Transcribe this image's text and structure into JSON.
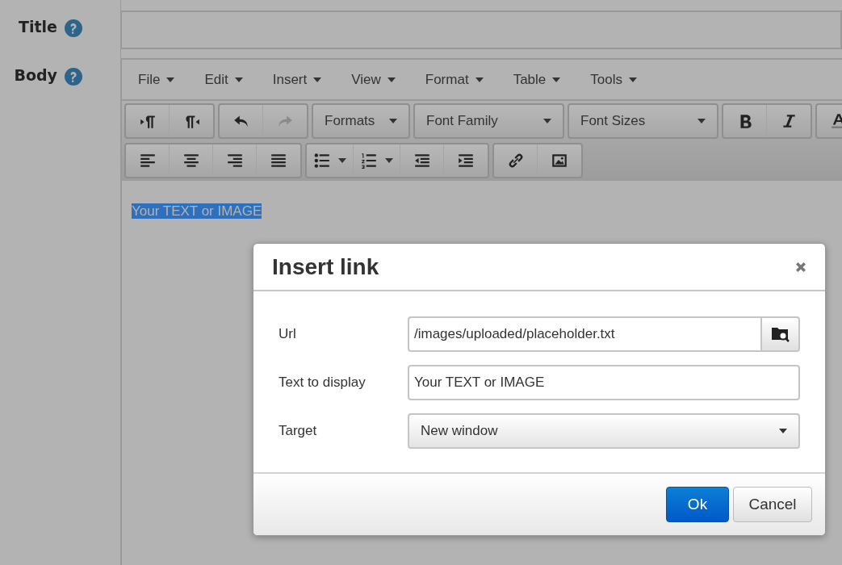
{
  "form": {
    "fields": [
      {
        "label": "Title",
        "kind": "text"
      },
      {
        "label": "Body",
        "kind": "editor"
      }
    ]
  },
  "editor": {
    "menu": [
      {
        "label": "File"
      },
      {
        "label": "Edit"
      },
      {
        "label": "Insert"
      },
      {
        "label": "View"
      },
      {
        "label": "Format"
      },
      {
        "label": "Table"
      },
      {
        "label": "Tools"
      }
    ],
    "toolbar_rows": [
      [
        [
          {
            "kind": "icon",
            "disabled": false
          },
          {
            "kind": "icon",
            "disabled": false
          }
        ],
        [
          {
            "kind": "icon",
            "disabled": false
          },
          {
            "kind": "icon",
            "disabled": true
          }
        ],
        [
          {
            "kind": "dropdown",
            "label": "Formats"
          }
        ],
        [
          {
            "kind": "dropdown",
            "label": "Font Family"
          }
        ],
        [
          {
            "kind": "dropdown",
            "label": "Font Sizes"
          }
        ],
        [
          {
            "kind": "icon",
            "disabled": false
          },
          {
            "kind": "icon",
            "disabled": false
          }
        ],
        [
          {
            "kind": "icon",
            "disabled": false
          }
        ]
      ],
      [
        [
          {
            "kind": "icon",
            "disabled": false
          },
          {
            "kind": "icon",
            "disabled": false
          },
          {
            "kind": "icon",
            "disabled": false
          },
          {
            "kind": "icon",
            "disabled": false
          }
        ],
        [
          {
            "kind": "split",
            "disabled": false
          },
          {
            "kind": "split",
            "disabled": false
          },
          {
            "kind": "icon",
            "disabled": false
          },
          {
            "kind": "icon",
            "disabled": false
          }
        ],
        [
          {
            "kind": "icon",
            "disabled": false
          },
          {
            "kind": "icon",
            "disabled": false
          }
        ]
      ]
    ],
    "content": {
      "text": "Your TEXT or IMAGE",
      "selected": true
    }
  },
  "dialog": {
    "title": "Insert link",
    "fields": [
      {
        "label": "Url",
        "kind": "browse",
        "value": "/images/uploaded/placeholder.txt"
      },
      {
        "label": "Text to display",
        "kind": "text",
        "value": "Your TEXT or IMAGE"
      },
      {
        "label": "Target",
        "kind": "select",
        "value": "New window"
      }
    ],
    "buttons": [
      {
        "label": "Ok",
        "primary": true
      },
      {
        "label": "Cancel",
        "primary": false
      }
    ]
  }
}
